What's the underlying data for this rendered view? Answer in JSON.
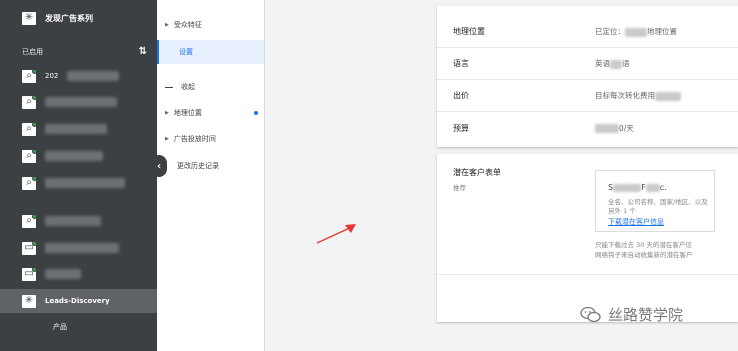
{
  "sidebar": {
    "account_title": "发现广告系列",
    "section_label": "已启用",
    "row1_text": "202",
    "active_campaign": "Leads-Discovery",
    "active_sub": "产品"
  },
  "nav": {
    "audience": "受众特征",
    "settings": "设置",
    "collapse": "收起",
    "location": "地理位置",
    "schedule": "广告投放时间",
    "history": "更改历史记录"
  },
  "settings": {
    "location_key": "地理位置",
    "location_value_prefix": "已定位：",
    "location_value_suffix": "地理位置",
    "language_key": "语言",
    "language_value_a": "英语",
    "language_value_b": "语",
    "bid_key": "出价",
    "bid_value": "目标每次转化费用",
    "budget_key": "预算",
    "budget_value": "0/天"
  },
  "lead_form": {
    "title": "潜在客户表单",
    "subtitle": "推荐",
    "preview_name_a": "S",
    "preview_name_b": "F",
    "preview_name_c": "c.",
    "preview_desc": "全名、公司名称、国家/地区、以及另外 1 个",
    "download_link": "下载潜在客户信息",
    "note_line1": "只能下载过去 30 天的潜在客户信",
    "note_line2": "网络钩子来自动收集新的潜在客户"
  },
  "watermark": "丝路赞学院",
  "colors": {
    "sidebar_bg": "#3c4043",
    "accent": "#1a73e8",
    "enabled_dot": "#34a853",
    "arrow": "#e53935"
  }
}
